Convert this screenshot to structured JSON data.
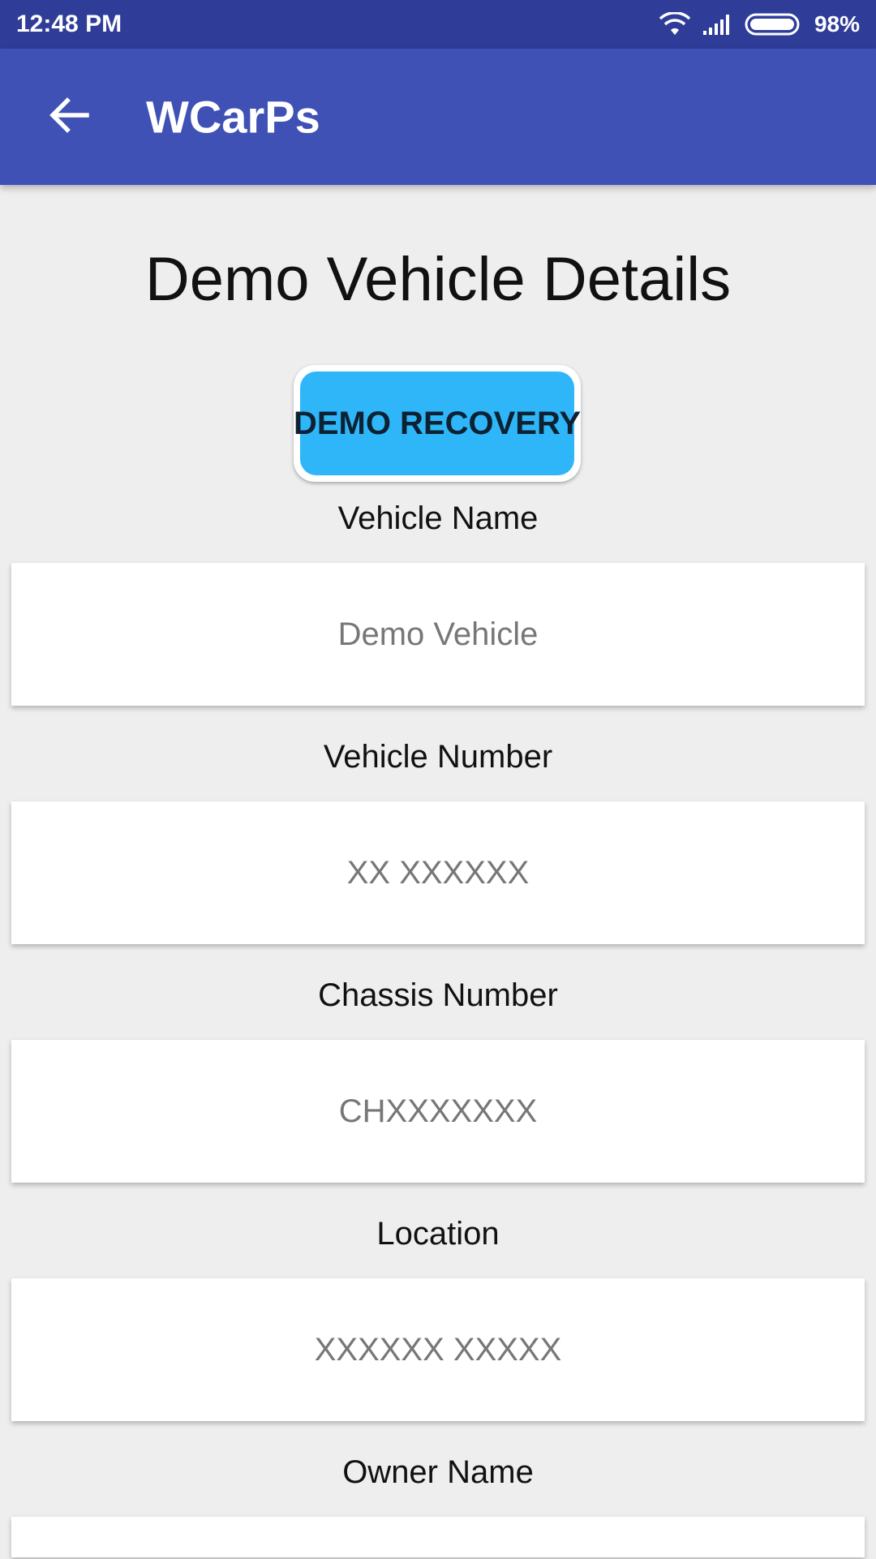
{
  "status_bar": {
    "time": "12:48 PM",
    "battery_percent": "98%",
    "icons": [
      "wifi-icon",
      "signal-icon",
      "battery-icon"
    ],
    "background_color": "#2f3d99"
  },
  "app_bar": {
    "title": "WCarPs",
    "back_icon": "arrow-back-icon",
    "background_color": "#3f51b5"
  },
  "page": {
    "title": "Demo Vehicle Details"
  },
  "demo_button": {
    "label": "DEMO RECOVERY",
    "color": "#2fb6f9"
  },
  "fields": [
    {
      "label": "Vehicle Name",
      "placeholder": "Demo Vehicle"
    },
    {
      "label": "Vehicle Number",
      "placeholder": "XX XXXXXX"
    },
    {
      "label": "Chassis Number",
      "placeholder": "CHXXXXXXX"
    },
    {
      "label": "Location",
      "placeholder": "XXXXXX XXXXX"
    },
    {
      "label": "Owner Name",
      "placeholder": ""
    }
  ]
}
